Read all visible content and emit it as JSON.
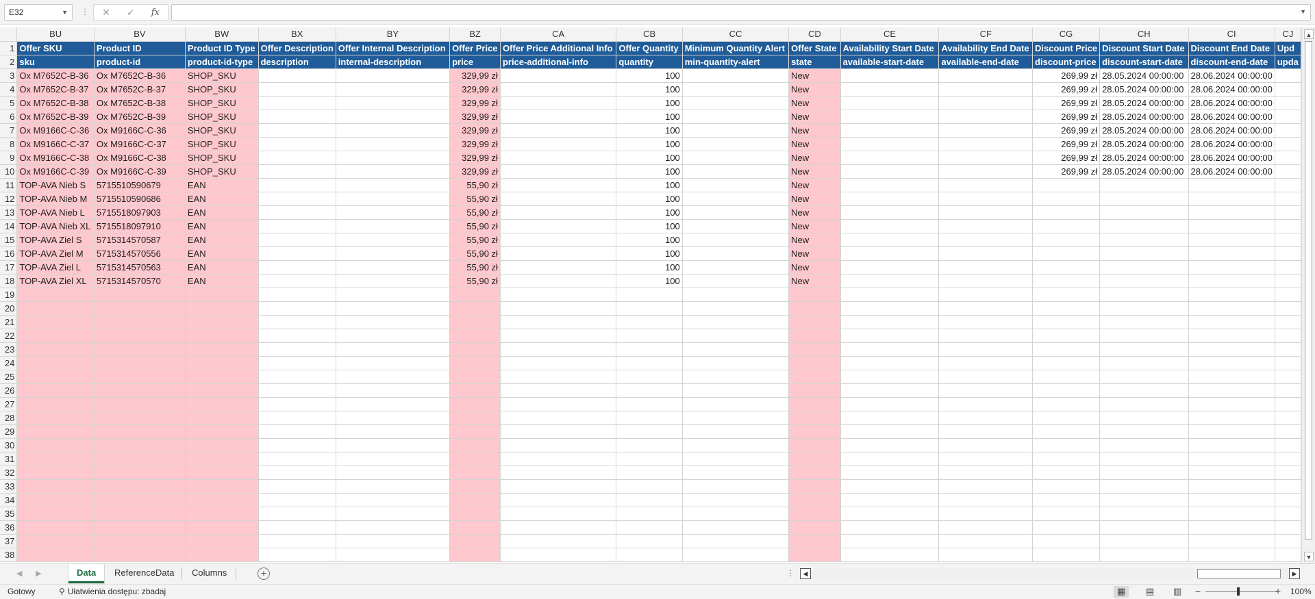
{
  "formula_bar": {
    "name_box": "E32",
    "separator": "⋮",
    "cancel_icon": "✕",
    "enter_icon": "✓",
    "fx_label": "fx",
    "formula": ""
  },
  "columns": [
    {
      "letter": "BU",
      "width": 113
    },
    {
      "letter": "BV",
      "width": 140
    },
    {
      "letter": "BW",
      "width": 107
    },
    {
      "letter": "BX",
      "width": 113
    },
    {
      "letter": "BY",
      "width": 167
    },
    {
      "letter": "BZ",
      "width": 74
    },
    {
      "letter": "CA",
      "width": 170
    },
    {
      "letter": "CB",
      "width": 97
    },
    {
      "letter": "CC",
      "width": 156
    },
    {
      "letter": "CD",
      "width": 76
    },
    {
      "letter": "CE",
      "width": 145
    },
    {
      "letter": "CF",
      "width": 137
    },
    {
      "letter": "CG",
      "width": 97
    },
    {
      "letter": "CH",
      "width": 130
    },
    {
      "letter": "CI",
      "width": 122
    },
    {
      "letter": "CJ",
      "width": 30
    }
  ],
  "pink_columns": [
    0,
    1,
    2,
    5,
    9
  ],
  "numeric_columns": [
    5,
    7,
    12
  ],
  "header_rows": [
    [
      "Offer SKU",
      "Product ID",
      "Product ID Type",
      "Offer Description",
      "Offer Internal Description",
      "Offer Price",
      "Offer Price Additional Info",
      "Offer Quantity",
      "Minimum Quantity Alert",
      "Offer State",
      "Availability Start Date",
      "Availability End Date",
      "Discount Price",
      "Discount Start Date",
      "Discount End Date",
      "Upd"
    ],
    [
      "sku",
      "product-id",
      "product-id-type",
      "description",
      "internal-description",
      "price",
      "price-additional-info",
      "quantity",
      "min-quantity-alert",
      "state",
      "available-start-date",
      "available-end-date",
      "discount-price",
      "discount-start-date",
      "discount-end-date",
      "upda"
    ]
  ],
  "data_rows": [
    [
      "Ox M7652C-B-36",
      "Ox M7652C-B-36",
      "SHOP_SKU",
      "",
      "",
      "329,99 zł",
      "",
      "100",
      "",
      "New",
      "",
      "",
      "269,99 zł",
      "28.05.2024 00:00:00",
      "28.06.2024 00:00:00",
      ""
    ],
    [
      "Ox M7652C-B-37",
      "Ox M7652C-B-37",
      "SHOP_SKU",
      "",
      "",
      "329,99 zł",
      "",
      "100",
      "",
      "New",
      "",
      "",
      "269,99 zł",
      "28.05.2024 00:00:00",
      "28.06.2024 00:00:00",
      ""
    ],
    [
      "Ox M7652C-B-38",
      "Ox M7652C-B-38",
      "SHOP_SKU",
      "",
      "",
      "329,99 zł",
      "",
      "100",
      "",
      "New",
      "",
      "",
      "269,99 zł",
      "28.05.2024 00:00:00",
      "28.06.2024 00:00:00",
      ""
    ],
    [
      "Ox M7652C-B-39",
      "Ox M7652C-B-39",
      "SHOP_SKU",
      "",
      "",
      "329,99 zł",
      "",
      "100",
      "",
      "New",
      "",
      "",
      "269,99 zł",
      "28.05.2024 00:00:00",
      "28.06.2024 00:00:00",
      ""
    ],
    [
      "Ox M9166C-C-36",
      "Ox M9166C-C-36",
      "SHOP_SKU",
      "",
      "",
      "329,99 zł",
      "",
      "100",
      "",
      "New",
      "",
      "",
      "269,99 zł",
      "28.05.2024 00:00:00",
      "28.06.2024 00:00:00",
      ""
    ],
    [
      "Ox M9166C-C-37",
      "Ox M9166C-C-37",
      "SHOP_SKU",
      "",
      "",
      "329,99 zł",
      "",
      "100",
      "",
      "New",
      "",
      "",
      "269,99 zł",
      "28.05.2024 00:00:00",
      "28.06.2024 00:00:00",
      ""
    ],
    [
      "Ox M9166C-C-38",
      "Ox M9166C-C-38",
      "SHOP_SKU",
      "",
      "",
      "329,99 zł",
      "",
      "100",
      "",
      "New",
      "",
      "",
      "269,99 zł",
      "28.05.2024 00:00:00",
      "28.06.2024 00:00:00",
      ""
    ],
    [
      "Ox M9166C-C-39",
      "Ox M9166C-C-39",
      "SHOP_SKU",
      "",
      "",
      "329,99 zł",
      "",
      "100",
      "",
      "New",
      "",
      "",
      "269,99 zł",
      "28.05.2024 00:00:00",
      "28.06.2024 00:00:00",
      ""
    ],
    [
      "TOP-AVA Nieb S",
      "5715510590679",
      "EAN",
      "",
      "",
      "55,90 zł",
      "",
      "100",
      "",
      "New",
      "",
      "",
      "",
      "",
      "",
      ""
    ],
    [
      "TOP-AVA Nieb M",
      "5715510590686",
      "EAN",
      "",
      "",
      "55,90 zł",
      "",
      "100",
      "",
      "New",
      "",
      "",
      "",
      "",
      "",
      ""
    ],
    [
      "TOP-AVA Nieb L",
      "5715518097903",
      "EAN",
      "",
      "",
      "55,90 zł",
      "",
      "100",
      "",
      "New",
      "",
      "",
      "",
      "",
      "",
      ""
    ],
    [
      "TOP-AVA Nieb XL",
      "5715518097910",
      "EAN",
      "",
      "",
      "55,90 zł",
      "",
      "100",
      "",
      "New",
      "",
      "",
      "",
      "",
      "",
      ""
    ],
    [
      "TOP-AVA Ziel S",
      "5715314570587",
      "EAN",
      "",
      "",
      "55,90 zł",
      "",
      "100",
      "",
      "New",
      "",
      "",
      "",
      "",
      "",
      ""
    ],
    [
      "TOP-AVA Ziel M",
      "5715314570556",
      "EAN",
      "",
      "",
      "55,90 zł",
      "",
      "100",
      "",
      "New",
      "",
      "",
      "",
      "",
      "",
      ""
    ],
    [
      "TOP-AVA Ziel L",
      "5715314570563",
      "EAN",
      "",
      "",
      "55,90 zł",
      "",
      "100",
      "",
      "New",
      "",
      "",
      "",
      "",
      "",
      ""
    ],
    [
      "TOP-AVA Ziel XL",
      "5715314570570",
      "EAN",
      "",
      "",
      "55,90 zł",
      "",
      "100",
      "",
      "New",
      "",
      "",
      "",
      "",
      "",
      ""
    ]
  ],
  "row_numbers": [
    "1",
    "2",
    "3",
    "4",
    "5",
    "6",
    "7",
    "8",
    "9",
    "10",
    "11",
    "12",
    "13",
    "14",
    "15",
    "16",
    "17",
    "18",
    "19",
    "20",
    "21",
    "22",
    "23",
    "24",
    "25",
    "26",
    "27",
    "28",
    "29",
    "30",
    "31",
    "32",
    "33",
    "34",
    "35",
    "36",
    "37",
    "38"
  ],
  "sheet_tabs": [
    {
      "label": "Data",
      "active": true
    },
    {
      "label": "ReferenceData",
      "active": false
    },
    {
      "label": "Columns",
      "active": false
    }
  ],
  "tabs_bar": {
    "prev_icon": "◀",
    "next_icon": "▶",
    "add_sheet": "+",
    "more": "⋮"
  },
  "status_bar": {
    "ready": "Gotowy",
    "accessibility": "Ułatwienia dostępu: zbadaj",
    "zoom_minus": "−",
    "zoom_plus": "+",
    "zoom": "100%"
  },
  "colors": {
    "header_bg": "#1f5c99",
    "header_text": "#ffffff",
    "required_fill": "#ffc7ce",
    "active_tab": "#1e6e42"
  }
}
